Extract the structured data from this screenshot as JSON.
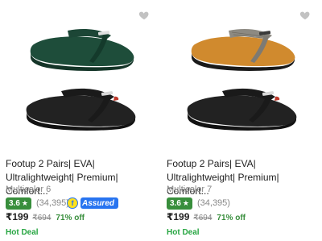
{
  "products": [
    {
      "title": "Footup 2 Pairs| EVA| Ultralightweight| Premium| Comfort...",
      "variant": "Multicolor 6",
      "rating": "3.6",
      "rating_count": "(34,395)",
      "assured_label": "Assured",
      "price": "₹199",
      "mrp": "₹694",
      "discount": "71% off",
      "deal": "Hot Deal",
      "top_color": "#1e4d3a",
      "strap_color": "#1c4636",
      "bottom_color": "#1a1a1a",
      "accent": "#c0392b"
    },
    {
      "title": "Footup 2 Pairs| EVA| Ultralightweight| Premium| Comfort...",
      "variant": "Multicolor 7",
      "rating": "3.6",
      "rating_count": "(34,395)",
      "price": "₹199",
      "mrp": "₹694",
      "discount": "71% off",
      "deal": "Hot Deal",
      "top_color": "#d08a2e",
      "strap_color": "#8d8a82",
      "bottom_color": "#1a1a1a",
      "accent": "#c0392b"
    }
  ],
  "icons": {
    "wishlist": "heart-icon",
    "rating": "star-icon",
    "assured": "flipkart-assured-icon"
  }
}
